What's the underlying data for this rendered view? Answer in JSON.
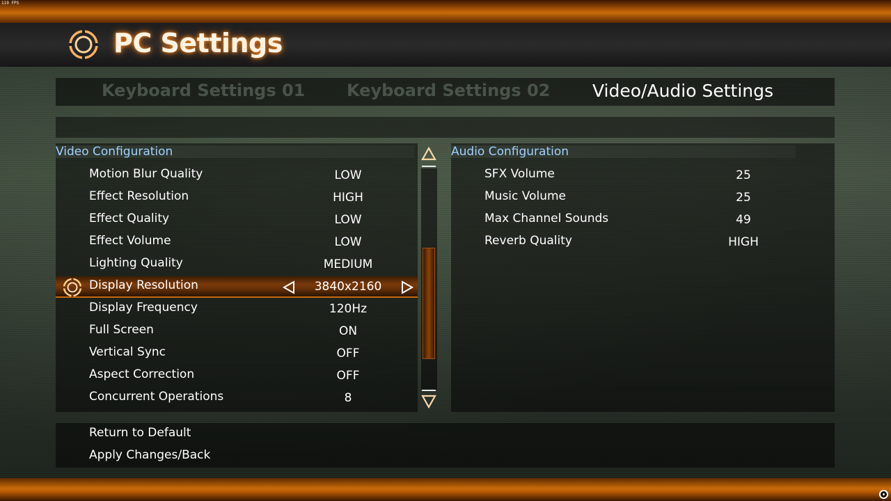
{
  "fps": "119 FPS",
  "header": {
    "title": "PC Settings"
  },
  "tabs": [
    {
      "label": "Keyboard Settings 01",
      "active": false
    },
    {
      "label": "Keyboard Settings 02",
      "active": false
    },
    {
      "label": "Video/Audio Settings",
      "active": true
    }
  ],
  "video": {
    "title": "Video Configuration",
    "rows": [
      {
        "label": "Motion Blur Quality",
        "value": "LOW"
      },
      {
        "label": "Effect Resolution",
        "value": "HIGH"
      },
      {
        "label": "Effect Quality",
        "value": "LOW"
      },
      {
        "label": "Effect Volume",
        "value": "LOW"
      },
      {
        "label": "Lighting Quality",
        "value": "MEDIUM"
      },
      {
        "label": "Display Resolution",
        "value": "3840x2160",
        "selected": true
      },
      {
        "label": "Display Frequency",
        "value": "120Hz"
      },
      {
        "label": "Full Screen",
        "value": "ON"
      },
      {
        "label": "Vertical Sync",
        "value": "OFF"
      },
      {
        "label": "Aspect Correction",
        "value": "OFF"
      },
      {
        "label": "Concurrent Operations",
        "value": "8"
      }
    ]
  },
  "audio": {
    "title": "Audio Configuration",
    "rows": [
      {
        "label": "SFX Volume",
        "value": "25"
      },
      {
        "label": "Music Volume",
        "value": "25"
      },
      {
        "label": "Max Channel Sounds",
        "value": "49"
      },
      {
        "label": "Reverb Quality",
        "value": "HIGH"
      }
    ]
  },
  "actions": {
    "return_default": "Return to Default",
    "apply_back": "Apply Changes/Back"
  },
  "colors": {
    "accent": "#c96a0a",
    "section_title": "#9fd0ff",
    "title_glow": "#ff8a1a"
  },
  "icons": {
    "header": "ring-logo-icon",
    "selected": "ring-cursor-icon",
    "scroll_up": "triangle-up-icon",
    "scroll_down": "triangle-down-icon",
    "value_prev": "triangle-left-icon",
    "value_next": "triangle-right-icon"
  }
}
